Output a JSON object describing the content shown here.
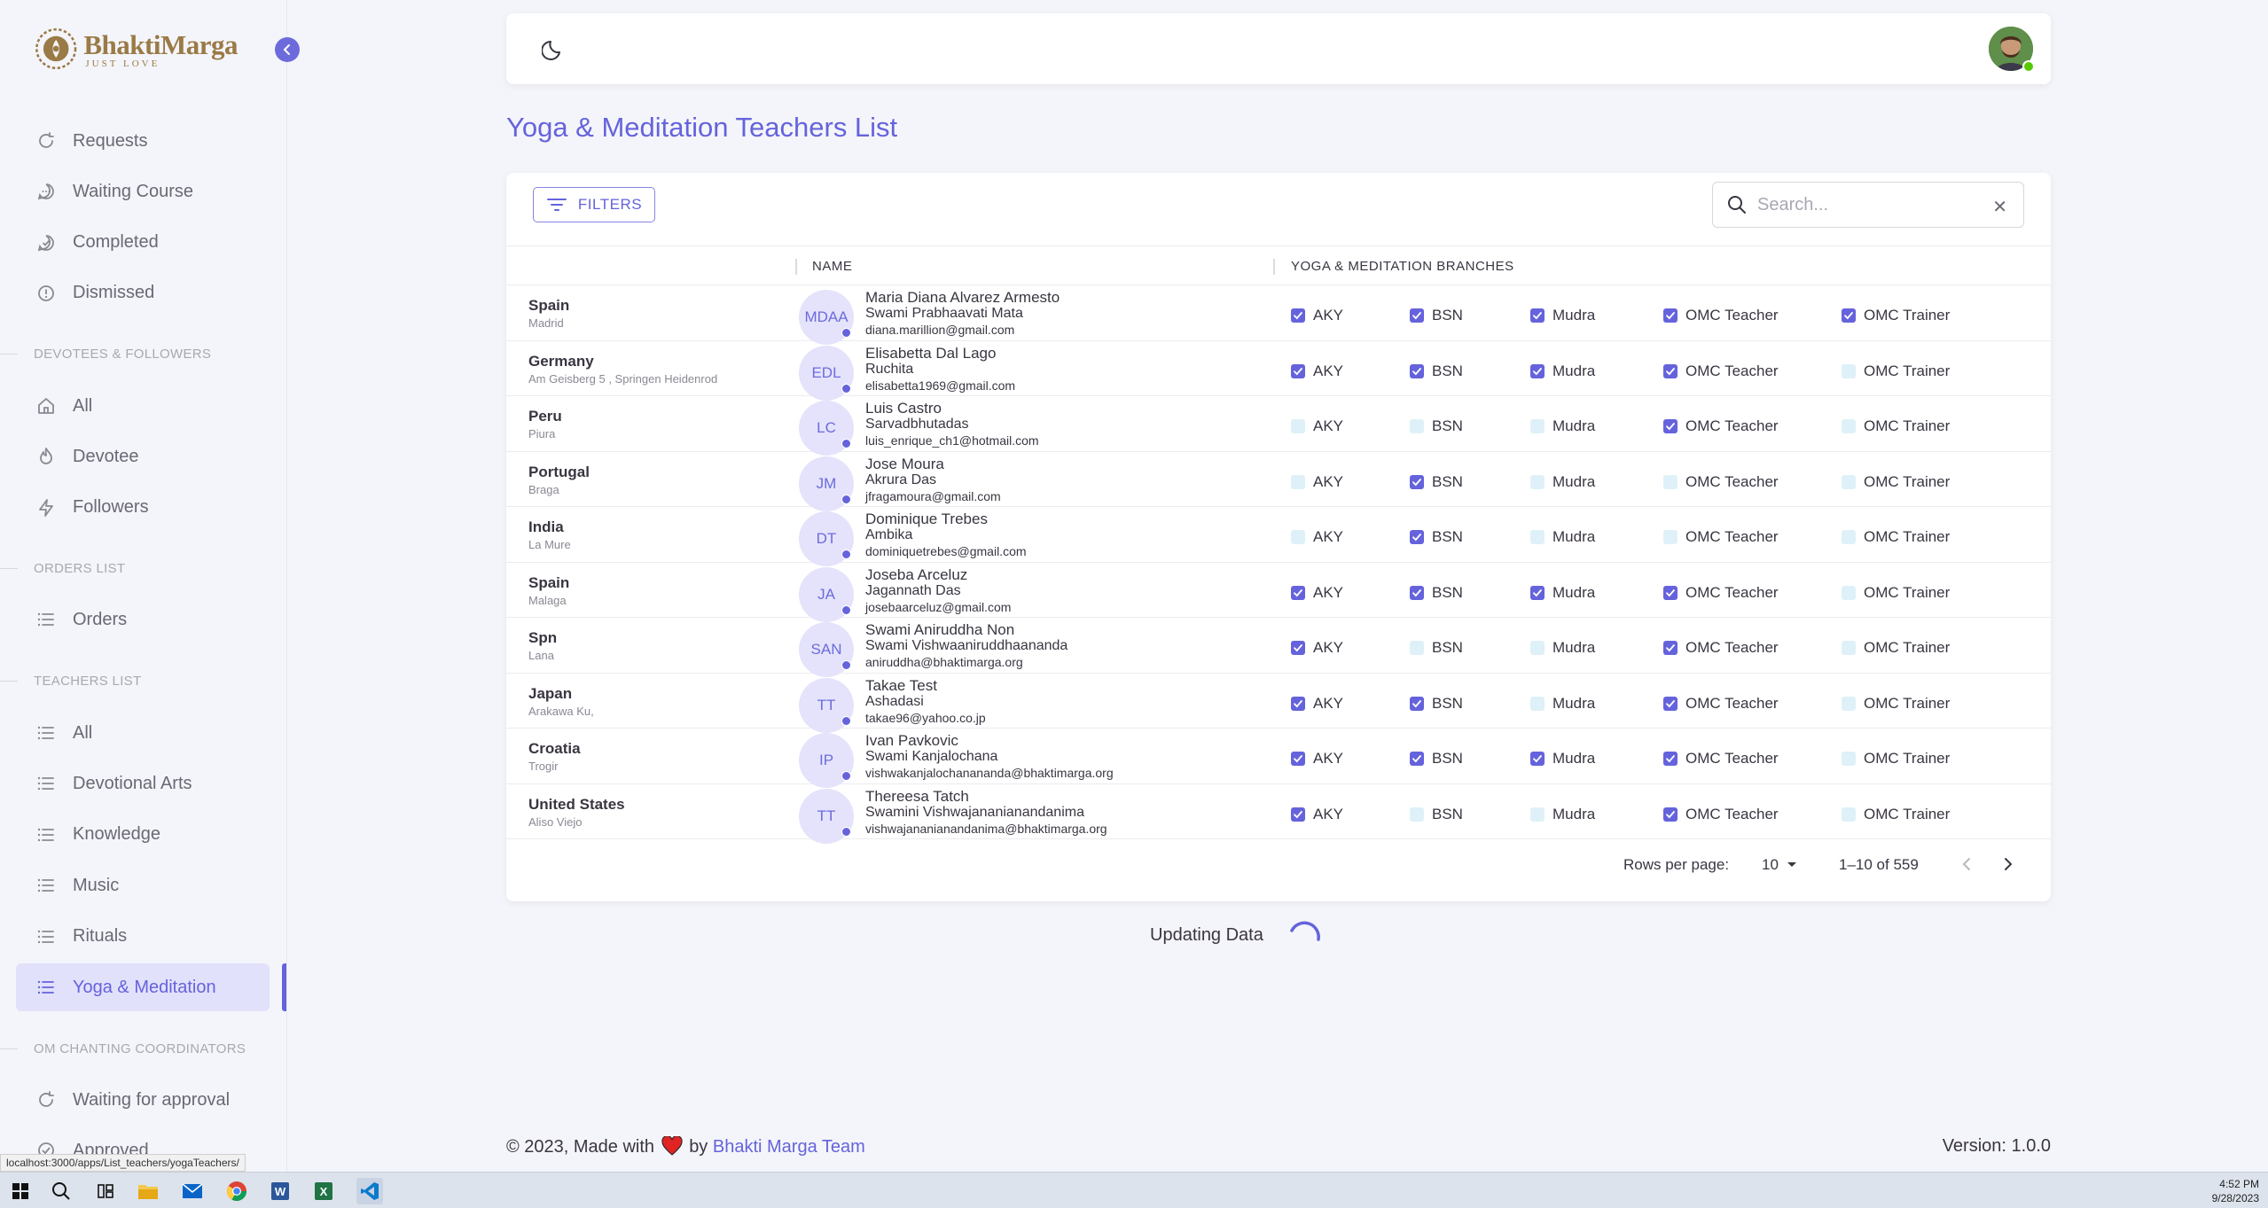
{
  "brand": {
    "name": "BhaktiMarga",
    "tagline": "JUST LOVE"
  },
  "sidebar": {
    "requests_section": [
      {
        "label": "Requests",
        "icon": "refresh-icon"
      },
      {
        "label": "Waiting Course",
        "icon": "chat-icon"
      },
      {
        "label": "Completed",
        "icon": "check-chat-icon"
      },
      {
        "label": "Dismissed",
        "icon": "alert-circle-icon"
      }
    ],
    "devotees_title": "DEVOTEES & FOLLOWERS",
    "devotees_items": [
      {
        "label": "All",
        "icon": "home-icon"
      },
      {
        "label": "Devotee",
        "icon": "flame-icon"
      },
      {
        "label": "Followers",
        "icon": "bolt-icon"
      }
    ],
    "orders_title": "ORDERS LIST",
    "orders_items": [
      {
        "label": "Orders",
        "icon": "list-icon"
      }
    ],
    "teachers_title": "TEACHERS LIST",
    "teachers_items": [
      {
        "label": "All",
        "icon": "list-icon"
      },
      {
        "label": "Devotional Arts",
        "icon": "list-icon"
      },
      {
        "label": "Knowledge",
        "icon": "list-icon"
      },
      {
        "label": "Music",
        "icon": "list-icon"
      },
      {
        "label": "Rituals",
        "icon": "list-icon"
      },
      {
        "label": "Yoga & Meditation",
        "icon": "list-icon",
        "active": true
      }
    ],
    "om_title": "OM CHANTING COORDINATORS",
    "om_items": [
      {
        "label": "Waiting for approval",
        "icon": "refresh-icon"
      },
      {
        "label": "Approved",
        "icon": "check-circle-icon"
      }
    ]
  },
  "page": {
    "title": "Yoga & Meditation Teachers List"
  },
  "toolbar": {
    "filters_label": "FILTERS",
    "search_placeholder": "Search..."
  },
  "table": {
    "headers": {
      "name": "NAME",
      "branches": "YOGA & MEDITATION BRANCHES"
    },
    "branch_labels": [
      "AKY",
      "BSN",
      "Mudra",
      "OMC Teacher",
      "OMC Trainer"
    ],
    "rows": [
      {
        "country": "Spain",
        "city": "Madrid",
        "initials": "MDAA",
        "name": "Maria Diana Alvarez Armesto",
        "spiritual": "Swami Prabhaavati Mata",
        "email": "diana.marillion@gmail.com",
        "branches": [
          true,
          true,
          true,
          true,
          true
        ]
      },
      {
        "country": "Germany",
        "city": "Am Geisberg 5 , Springen Heidenrod",
        "initials": "EDL",
        "name": "Elisabetta Dal Lago",
        "spiritual": "Ruchita",
        "email": "elisabetta1969@gmail.com",
        "branches": [
          true,
          true,
          true,
          true,
          false
        ]
      },
      {
        "country": "Peru",
        "city": "Piura",
        "initials": "LC",
        "name": "Luis Castro",
        "spiritual": "Sarvadbhutadas",
        "email": "luis_enrique_ch1@hotmail.com",
        "branches": [
          false,
          false,
          false,
          true,
          false
        ]
      },
      {
        "country": "Portugal",
        "city": "Braga",
        "initials": "JM",
        "name": "Jose Moura",
        "spiritual": "Akrura Das",
        "email": "jfragamoura@gmail.com",
        "branches": [
          false,
          true,
          false,
          false,
          false
        ]
      },
      {
        "country": "India",
        "city": "La Mure",
        "initials": "DT",
        "name": "Dominique Trebes",
        "spiritual": "Ambika",
        "email": "dominiquetrebes@gmail.com",
        "branches": [
          false,
          true,
          false,
          false,
          false
        ]
      },
      {
        "country": "Spain",
        "city": "Malaga",
        "initials": "JA",
        "name": "Joseba Arceluz",
        "spiritual": "Jagannath Das",
        "email": "josebaarceluz@gmail.com",
        "branches": [
          true,
          true,
          true,
          true,
          false
        ]
      },
      {
        "country": "Spn",
        "city": "Lana",
        "initials": "SAN",
        "name": "Swami Aniruddha Non",
        "spiritual": "Swami Vishwaaniruddhaananda",
        "email": "aniruddha@bhaktimarga.org",
        "branches": [
          true,
          false,
          false,
          true,
          false
        ]
      },
      {
        "country": "Japan",
        "city": "Arakawa Ku,",
        "initials": "TT",
        "name": "Takae Test",
        "spiritual": "Ashadasi",
        "email": "takae96@yahoo.co.jp",
        "branches": [
          true,
          true,
          false,
          true,
          false
        ]
      },
      {
        "country": "Croatia",
        "city": "Trogir",
        "initials": "IP",
        "name": "Ivan Pavkovic",
        "spiritual": "Swami Kanjalochana",
        "email": "vishwakanjalochanananda@bhaktimarga.org",
        "branches": [
          true,
          true,
          true,
          true,
          false
        ]
      },
      {
        "country": "United States",
        "city": "Aliso Viejo",
        "initials": "TT",
        "name": "Thereesa Tatch",
        "spiritual": "Swamini Vishwajananianandanima",
        "email": "vishwajananianandanima@bhaktimarga.org",
        "branches": [
          true,
          false,
          false,
          true,
          false
        ]
      }
    ]
  },
  "pagination": {
    "rows_per_page_label": "Rows per page:",
    "rows_per_page": "10",
    "range": "1–10 of 559"
  },
  "status": {
    "updating": "Updating Data"
  },
  "footer": {
    "prefix": "© 2023, Made with",
    "by": "by",
    "team": "Bhakti Marga Team",
    "version": "Version: 1.0.0"
  },
  "browser_status_url": "localhost:3000/apps/List_teachers/yogaTeachers/",
  "taskbar": {
    "time": "4:52 PM",
    "date": "9/28/2023"
  },
  "colors": {
    "accent": "#6563dc",
    "brand_gold": "#9a7a46",
    "background": "#f4f5fa",
    "unchecked": "#dff1f8"
  }
}
